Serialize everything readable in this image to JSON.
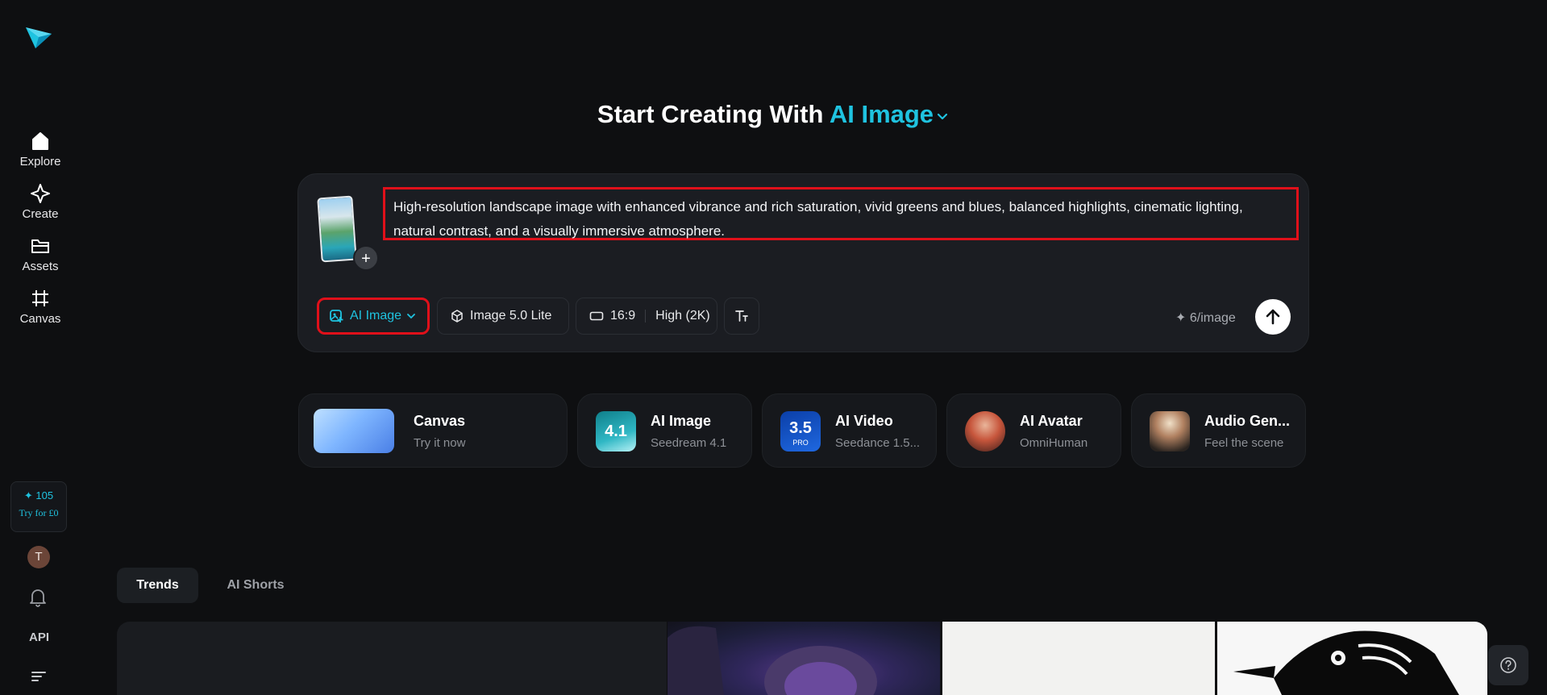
{
  "sidebar": {
    "logo": "paper-plane-logo",
    "nav": [
      {
        "label": "Explore",
        "icon": "home-icon"
      },
      {
        "label": "Create",
        "icon": "sparkle-icon"
      },
      {
        "label": "Assets",
        "icon": "folder-icon"
      },
      {
        "label": "Canvas",
        "icon": "frame-icon"
      }
    ],
    "credits": {
      "count": "105",
      "cta": "Try for £0"
    },
    "avatar_initial": "T",
    "api_label": "API"
  },
  "hero": {
    "title_prefix": "Start Creating With",
    "title_accent": "AI Image"
  },
  "prompt": {
    "text": "High-resolution landscape image with enhanced vibrance and rich saturation, vivid greens and blues, balanced highlights, cinematic lighting, natural contrast, and a visually immersive atmosphere.",
    "add_icon": "+"
  },
  "toolbar": {
    "mode": "AI Image",
    "model": "Image 5.0 Lite",
    "ratio": "16:9",
    "quality": "High (2K)",
    "cost": "6/image"
  },
  "cards": [
    {
      "title": "Canvas",
      "subtitle": "Try it now"
    },
    {
      "title": "AI Image",
      "subtitle": "Seedream 4.1",
      "badge": "4.1"
    },
    {
      "title": "AI Video",
      "subtitle": "Seedance 1.5...",
      "badge": "3.5",
      "badge_sub": "PRO"
    },
    {
      "title": "AI Avatar",
      "subtitle": "OmniHuman"
    },
    {
      "title": "Audio Gen...",
      "subtitle": "Feel the scene"
    }
  ],
  "tabs": [
    {
      "label": "Trends"
    },
    {
      "label": "AI Shorts"
    }
  ],
  "colors": {
    "accent": "#1fc3e0",
    "highlight_border": "#e0101a",
    "background": "#0e0f11",
    "panel": "#1b1d22"
  }
}
